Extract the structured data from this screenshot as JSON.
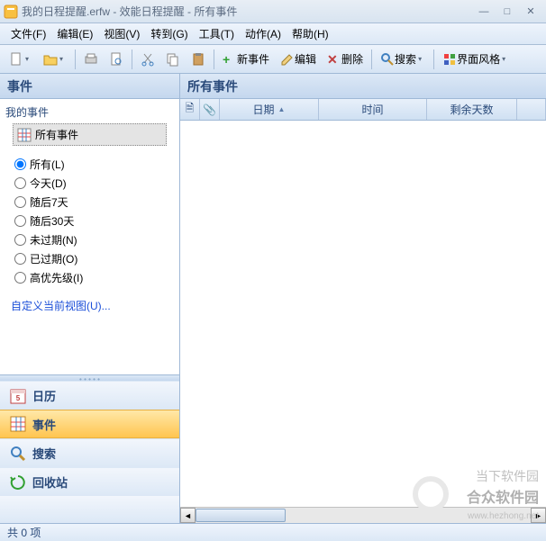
{
  "titlebar": {
    "text": "我的日程提醒.erfw - 效能日程提醒 - 所有事件"
  },
  "menu": {
    "file": "文件(F)",
    "edit": "编辑(E)",
    "view": "视图(V)",
    "goto": "转到(G)",
    "tools": "工具(T)",
    "action": "动作(A)",
    "help": "帮助(H)"
  },
  "toolbar": {
    "new_event": "新事件",
    "edit": "编辑",
    "delete": "删除",
    "search": "搜索",
    "skin": "界面风格"
  },
  "sidebar": {
    "header": "事件",
    "my_events": "我的事件",
    "all_events": "所有事件",
    "radios": {
      "all": "所有(L)",
      "today": "今天(D)",
      "next7": "随后7天",
      "next30": "随后30天",
      "notexp": "未过期(N)",
      "expired": "已过期(O)",
      "high": "高优先级(I)"
    },
    "custom_view": "自定义当前视图(U)...",
    "nav": {
      "calendar": "日历",
      "events": "事件",
      "search": "搜索",
      "recycle": "回收站"
    }
  },
  "main": {
    "header": "所有事件",
    "cols": {
      "date": "日期",
      "time": "时间",
      "days": "剩余天数"
    }
  },
  "status": {
    "text": "共 0 项"
  },
  "watermark": {
    "line1": "当下软件园",
    "line2": "合众软件园",
    "url": "www.hezhong.net"
  }
}
